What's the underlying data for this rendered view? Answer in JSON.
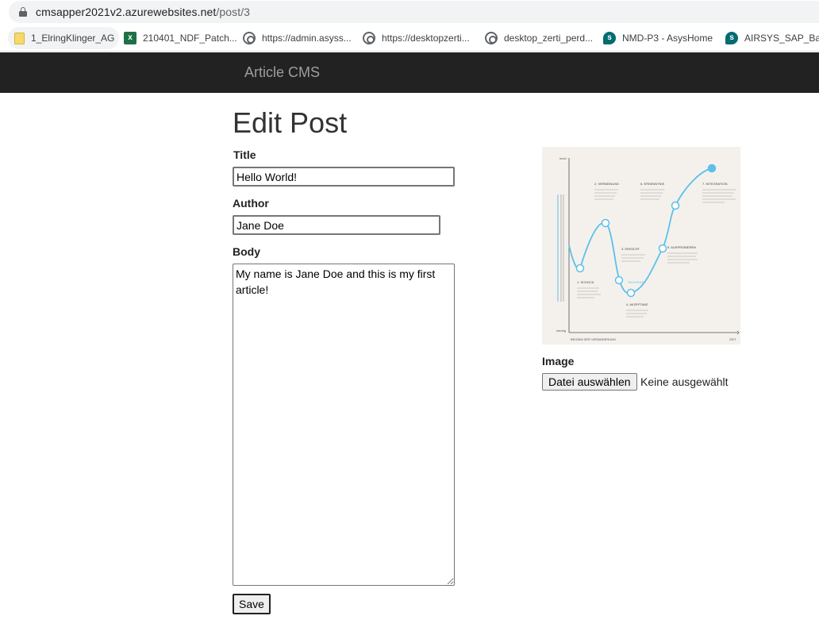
{
  "browser": {
    "url_host": "cmsapper2021v2.azurewebsites.net",
    "url_path": "/post/3",
    "bookmarks": [
      {
        "label": "1_ElringKlinger_AG",
        "icon": "folder-icon"
      },
      {
        "label": "210401_NDF_Patch...",
        "icon": "excel-icon"
      },
      {
        "label": "https://admin.asyss...",
        "icon": "site-icon"
      },
      {
        "label": "https://desktopzerti...",
        "icon": "site-icon"
      },
      {
        "label": "desktop_zerti_perd...",
        "icon": "site-icon"
      },
      {
        "label": "NMD-P3 - AsysHome",
        "icon": "sharepoint-icon"
      },
      {
        "label": "AIRSYS_SAP_Basis",
        "icon": "sharepoint-icon"
      }
    ]
  },
  "navbar": {
    "brand": "Article CMS"
  },
  "form": {
    "heading": "Edit Post",
    "title_label": "Title",
    "title_value": "Hello World!",
    "author_label": "Author",
    "author_value": "Jane Doe",
    "body_label": "Body",
    "body_value": "My name is Jane Doe and this is my first article!",
    "save_label": "Save",
    "image_label": "Image",
    "file_button_label": "Datei auswählen",
    "file_status": "Keine ausgewählt"
  },
  "preview_image": {
    "axis_top": "hoch",
    "axis_bottom": "niedrig",
    "axis_x_start": "BEGINN DER VERÄNDERUNG",
    "axis_x_end": "ZEIT",
    "valley_label": "TALSOHLE",
    "stages": [
      {
        "n": "1",
        "name": "1. SCHOCK"
      },
      {
        "n": "2",
        "name": "2. VERNEINUNG"
      },
      {
        "n": "3",
        "name": "3. EINSICHT"
      },
      {
        "n": "4",
        "name": "4. AKZEPTANZ"
      },
      {
        "n": "5",
        "name": "5. AUSPROBIEREN"
      },
      {
        "n": "6",
        "name": "6. ERKENNTNIS"
      },
      {
        "n": "7",
        "name": "7. INTEGRATION"
      }
    ]
  }
}
